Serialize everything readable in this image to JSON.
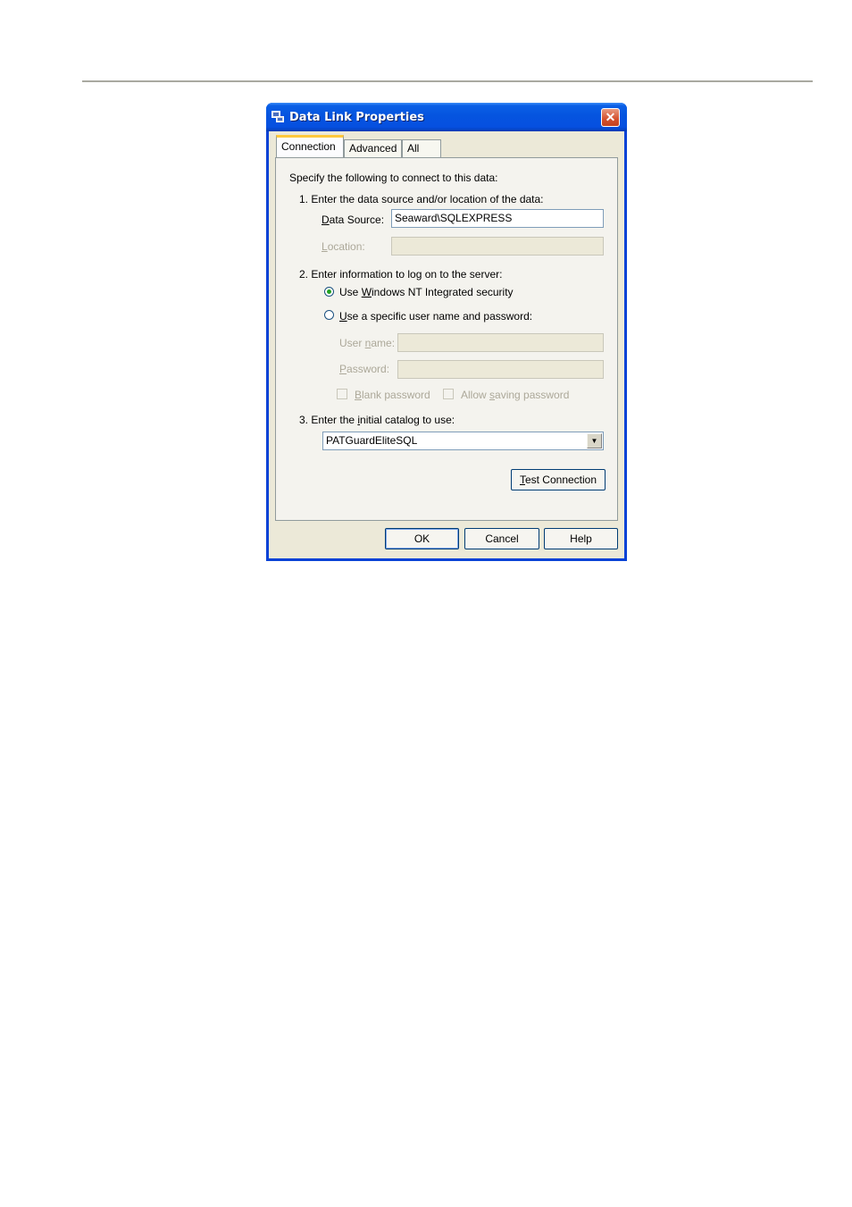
{
  "window": {
    "title": "Data Link Properties",
    "close_glyph": "✕"
  },
  "tabs": [
    {
      "label": "Connection",
      "active": true
    },
    {
      "label": "Advanced",
      "active": false
    },
    {
      "label": "All",
      "active": false
    }
  ],
  "connection": {
    "intro": "Specify the following to connect to this data:",
    "step1": "1. Enter the data source and/or location of the data:",
    "data_source_label": "Data Source:",
    "data_source_value": "Seaward\\SQLEXPRESS",
    "location_label": "Location:",
    "location_value": "",
    "step2": "2. Enter information to log on to the server:",
    "radio_nt": "Use Windows NT Integrated security",
    "radio_specific": "Use a specific user name and password:",
    "radio_selected": "nt",
    "username_label": "User name:",
    "username_value": "",
    "password_label": "Password:",
    "password_value": "",
    "blank_password": "Blank password",
    "allow_saving": "Allow saving password",
    "step3": "3. Enter the initial catalog to use:",
    "catalog_value": "PATGuardEliteSQL",
    "test_button": "Test Connection"
  },
  "buttons": {
    "ok": "OK",
    "cancel": "Cancel",
    "help": "Help"
  },
  "icons": {
    "title": "data-link-icon",
    "close": "close-icon",
    "dropdown": "chevron-down-icon"
  }
}
